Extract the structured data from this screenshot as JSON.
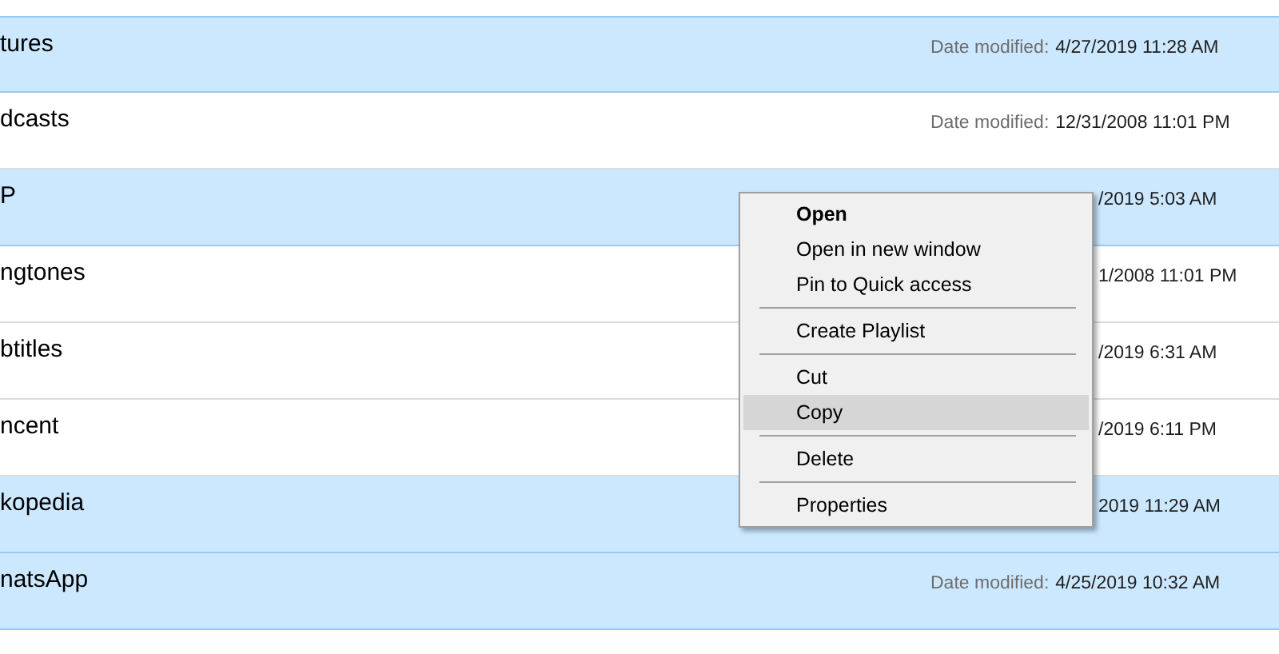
{
  "rows": [
    {
      "name": "tures",
      "selected": true,
      "date_label": "Date modified:",
      "date": "4/27/2019 11:28 AM"
    },
    {
      "name": "dcasts",
      "selected": false,
      "date_label": "Date modified:",
      "date": "12/31/2008 11:01 PM"
    },
    {
      "name": "P",
      "selected": true,
      "date": "/2019 5:03 AM"
    },
    {
      "name": "ngtones",
      "selected": false,
      "date": "1/2008 11:01 PM"
    },
    {
      "name": "btitles",
      "selected": false,
      "date": "/2019 6:31 AM"
    },
    {
      "name": "ncent",
      "selected": false,
      "date": "/2019 6:11 PM"
    },
    {
      "name": "kopedia",
      "selected": true,
      "date": "2019 11:29 AM"
    },
    {
      "name": "natsApp",
      "selected": true,
      "date_label": "Date modified:",
      "date": "4/25/2019 10:32 AM"
    }
  ],
  "context_menu": {
    "items": [
      {
        "kind": "item",
        "label": "Open",
        "bold": true,
        "selected": false
      },
      {
        "kind": "item",
        "label": "Open in new window",
        "bold": false,
        "selected": false
      },
      {
        "kind": "item",
        "label": "Pin to Quick access",
        "bold": false,
        "selected": false
      },
      {
        "kind": "separator"
      },
      {
        "kind": "item",
        "label": "Create Playlist",
        "bold": false,
        "selected": false
      },
      {
        "kind": "separator"
      },
      {
        "kind": "item",
        "label": "Cut",
        "bold": false,
        "selected": false
      },
      {
        "kind": "item",
        "label": "Copy",
        "bold": false,
        "selected": true
      },
      {
        "kind": "separator"
      },
      {
        "kind": "item",
        "label": "Delete",
        "bold": false,
        "selected": false
      },
      {
        "kind": "separator"
      },
      {
        "kind": "item",
        "label": "Properties",
        "bold": false,
        "selected": false
      }
    ]
  }
}
